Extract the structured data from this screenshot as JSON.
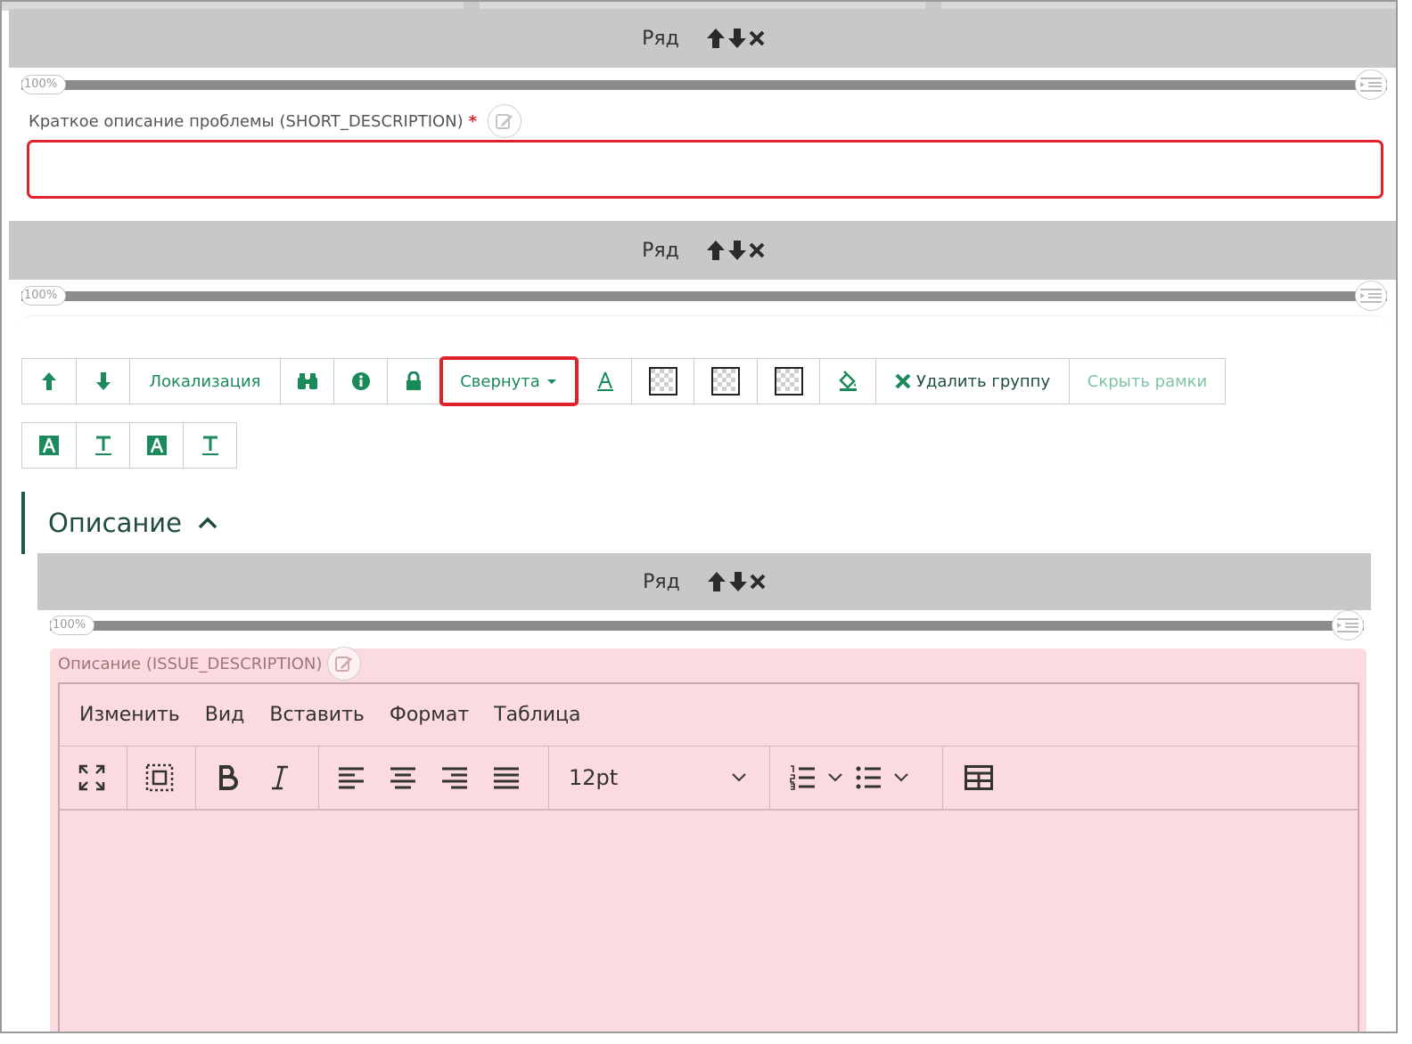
{
  "rows": {
    "label": "Ряд",
    "width_pct": "100%"
  },
  "short_description": {
    "label": "Краткое описание проблемы (SHORT_DESCRIPTION)",
    "required_mark": "*",
    "value": ""
  },
  "group_toolbar": {
    "localization": "Локализация",
    "collapsed": "Свернута",
    "delete_group": "Удалить группу",
    "hide_borders": "Скрыть рамки"
  },
  "section": {
    "title": "Описание"
  },
  "issue_description": {
    "label": "Описание (ISSUE_DESCRIPTION)"
  },
  "editor": {
    "menu": [
      "Изменить",
      "Вид",
      "Вставить",
      "Формат",
      "Таблица"
    ],
    "font_size": "12pt"
  },
  "colors": {
    "accent": "#1a8a5a",
    "highlight": "#e0202a",
    "row_header": "#c8c8c8",
    "invalid_field": "#fbdbe0"
  }
}
